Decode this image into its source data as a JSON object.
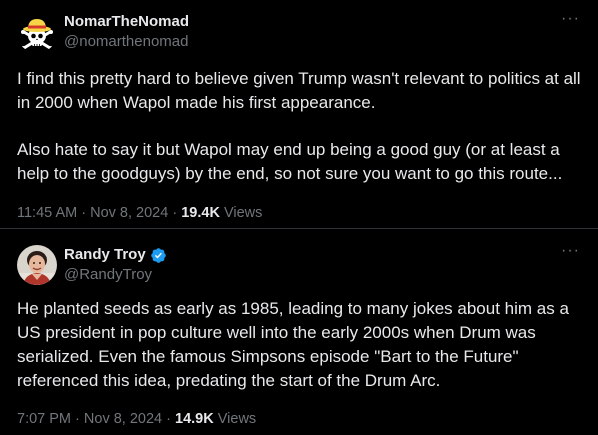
{
  "tweets": [
    {
      "display_name": "NomarTheNomad",
      "handle": "@nomarthenomad",
      "more": "···",
      "avatar_icon": "straw-hat-jolly-roger",
      "paragraphs": [
        "I find this pretty hard to believe given Trump wasn't relevant to politics at all in 2000 when Wapol made his first appearance.",
        "Also hate to say it but Wapol may end up being a good guy (or at least a help to the goodguys) by the end, so not sure you want to go this route..."
      ],
      "time": "11:45 AM",
      "sep1": "·",
      "date": "Nov 8, 2024",
      "sep2": "·",
      "views_count": "19.4K",
      "views_label": "Views"
    },
    {
      "display_name": "Randy Troy",
      "handle": "@RandyTroy",
      "more": "···",
      "avatar_icon": "user-photo",
      "verified_icon": "verified-badge",
      "verified_color": "#1d9bf0",
      "paragraphs": [
        "He planted seeds as early as 1985, leading to many jokes about him as a US president in pop culture well into the early 2000s when Drum was serialized.  Even the famous Simpsons episode \"Bart to the Future\" referenced this idea, predating the start of the Drum Arc."
      ],
      "time": "7:07 PM",
      "sep1": "·",
      "date": "Nov 8, 2024",
      "sep2": "·",
      "views_count": "14.9K",
      "views_label": "Views"
    }
  ],
  "colors": {
    "background": "#000000",
    "text": "#e7e9ea",
    "secondary": "#71767b",
    "divider": "#2f3336"
  }
}
